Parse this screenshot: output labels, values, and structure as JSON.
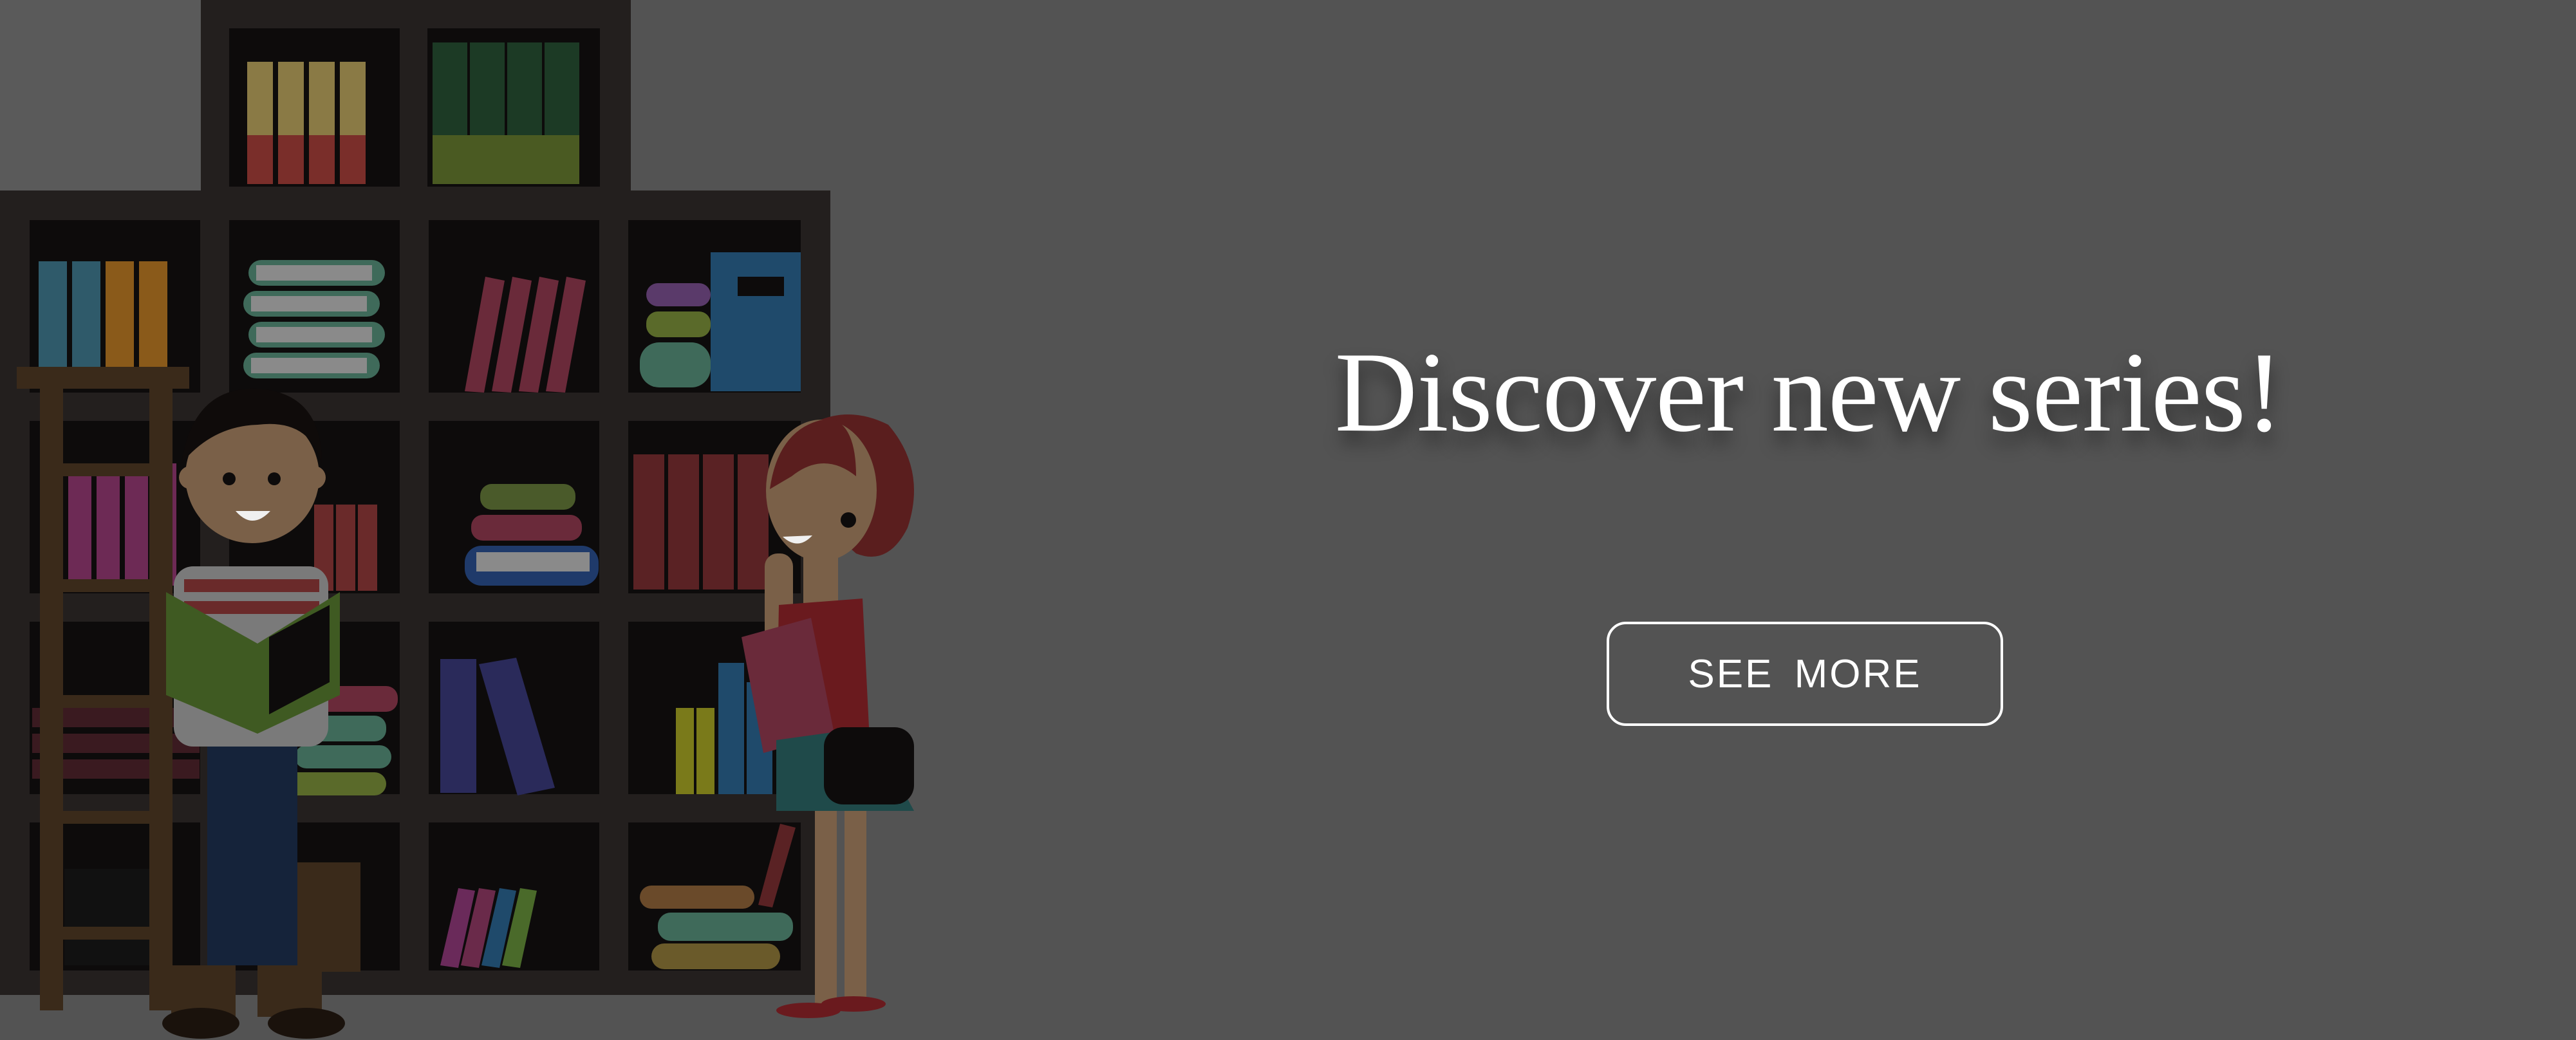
{
  "banner": {
    "headline": "Discover new series!",
    "cta_label": "SEE  MORE",
    "background_color": "#535353",
    "text_color": "#ffffff"
  },
  "illustration": {
    "subject": "two people reading in front of a bookshelf",
    "icons": [
      "bookshelf-icon",
      "ladder-icon",
      "boy-reading-icon",
      "girl-with-book-icon"
    ]
  },
  "colors": {
    "shelf": "#231f1e",
    "shelf_inner": "#0d0b0b",
    "book_red": "#7a2e35",
    "book_blue": "#1f4a6b",
    "book_green": "#1c3a25",
    "book_yellow": "#8a7a2a",
    "book_pink": "#7d2c55"
  }
}
